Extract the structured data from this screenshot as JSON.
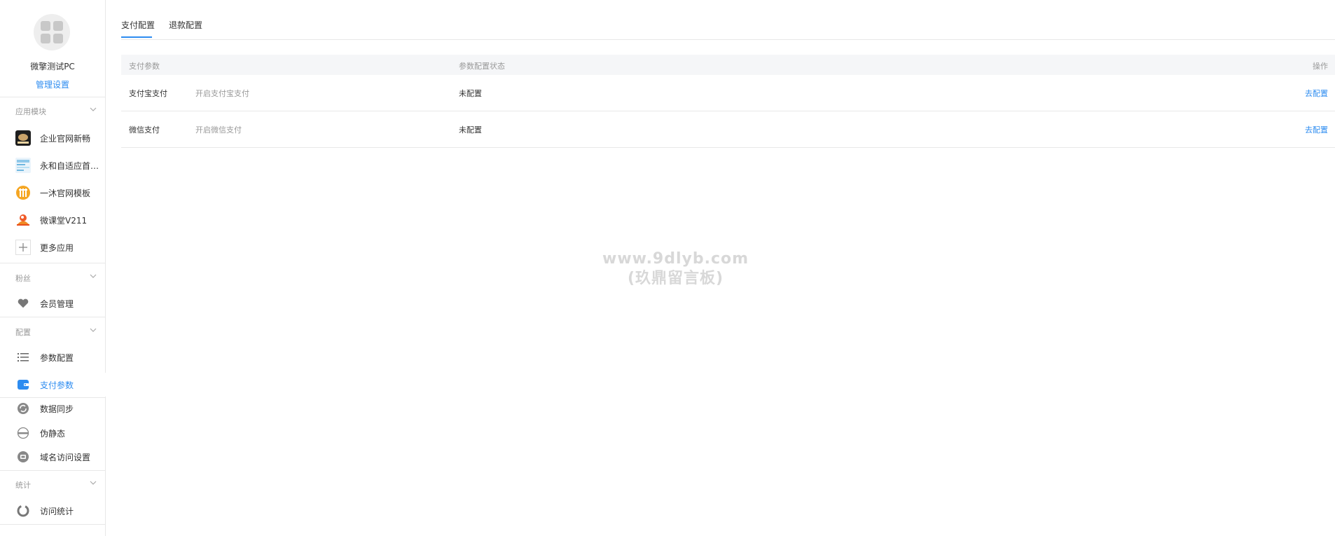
{
  "app": {
    "name": "微擎测试PC",
    "manage_label": "管理设置"
  },
  "sidebar": {
    "groups": [
      {
        "title": "应用模块",
        "items": [
          {
            "label": "企业官网新畅"
          },
          {
            "label": "永和自适应首页..."
          },
          {
            "label": "一沐官网模板"
          },
          {
            "label": "微课堂V211"
          },
          {
            "label": "更多应用"
          }
        ]
      },
      {
        "title": "粉丝",
        "items": [
          {
            "label": "会员管理"
          }
        ]
      },
      {
        "title": "配置",
        "items": [
          {
            "label": "参数配置"
          },
          {
            "label": "支付参数"
          },
          {
            "label": "数据同步"
          },
          {
            "label": "伪静态"
          },
          {
            "label": "域名访问设置"
          }
        ]
      },
      {
        "title": "统计",
        "items": [
          {
            "label": "访问统计"
          }
        ]
      }
    ]
  },
  "tabs": [
    {
      "label": "支付配置"
    },
    {
      "label": "退款配置"
    }
  ],
  "table": {
    "headers": {
      "param": "支付参数",
      "status": "参数配置状态",
      "action": "操作"
    },
    "rows": [
      {
        "name": "支付宝支付",
        "desc": "开启支付宝支付",
        "status": "未配置",
        "action": "去配置"
      },
      {
        "name": "微信支付",
        "desc": "开启微信支付",
        "status": "未配置",
        "action": "去配置"
      }
    ]
  },
  "watermark": {
    "line1": "www.9dlyb.com",
    "line2": "(玖鼎留言板)"
  },
  "colors": {
    "accent": "#2d8cf0",
    "muted": "#999999",
    "border": "#e8e8e8"
  }
}
